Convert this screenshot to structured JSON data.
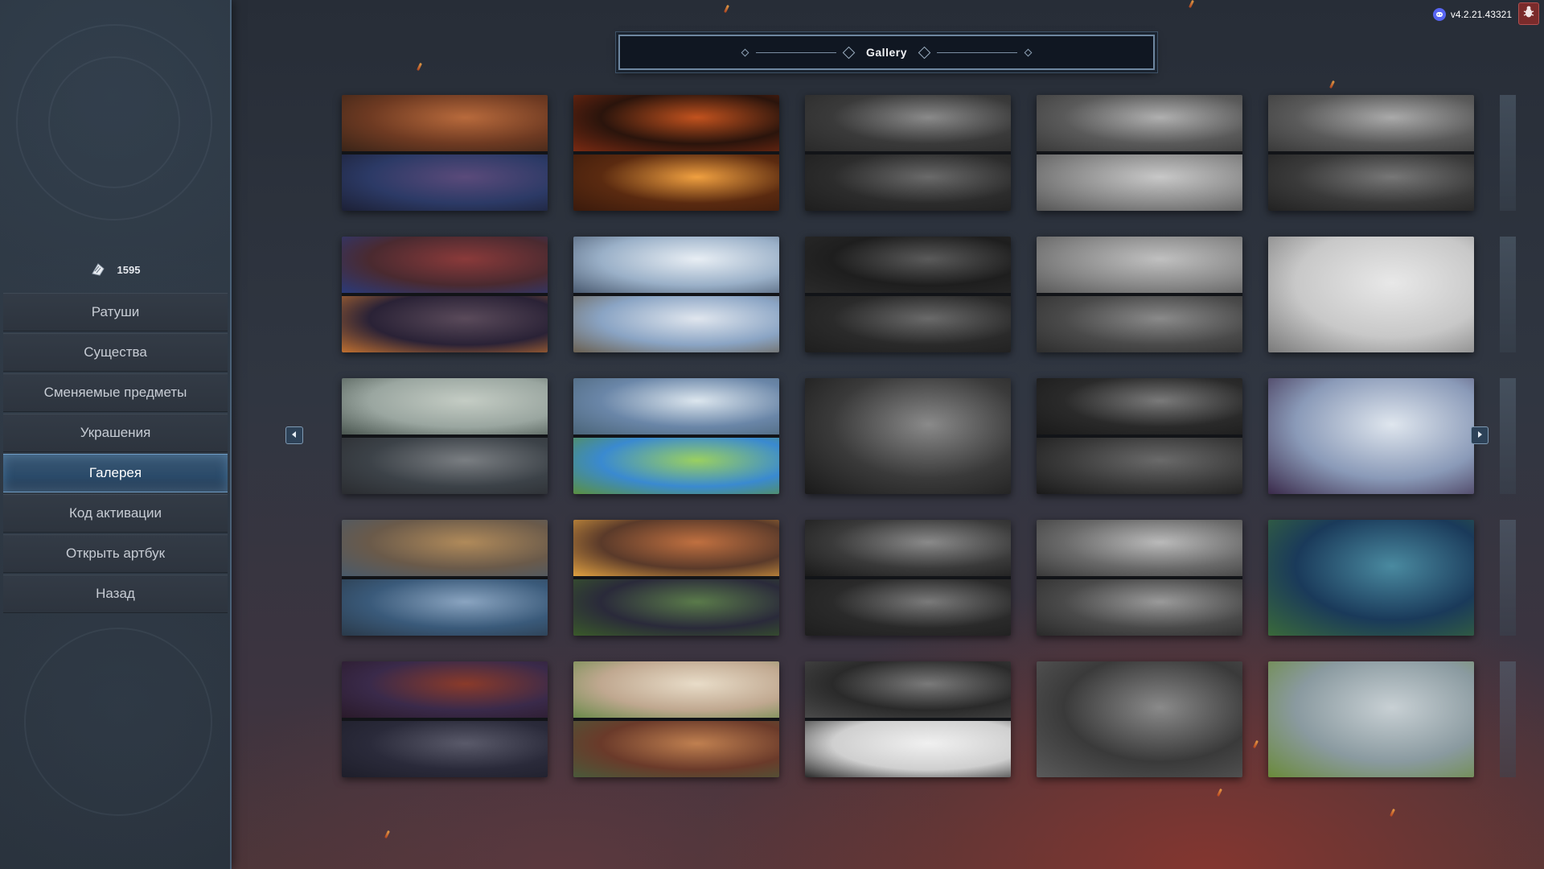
{
  "header": {
    "title": "Gallery"
  },
  "version": {
    "text": "v4.2.21.43321",
    "icon": "discord-icon"
  },
  "bug_report": {
    "icon": "bug-icon",
    "color": "#7a2b2b"
  },
  "currency": {
    "icon": "rune-shard-icon",
    "value": "1595"
  },
  "sidebar": {
    "items": [
      {
        "label": "Ратуши",
        "active": false
      },
      {
        "label": "Существа",
        "active": false
      },
      {
        "label": "Сменяемые предметы",
        "active": false
      },
      {
        "label": "Украшения",
        "active": false
      },
      {
        "label": "Галерея",
        "active": true
      },
      {
        "label": "Код активации",
        "active": false
      },
      {
        "label": "Открыть артбук",
        "active": false
      },
      {
        "label": "Назад",
        "active": false
      }
    ]
  },
  "gallery": {
    "navigation": {
      "prev_icon": "arrow-left-icon",
      "next_icon": "arrow-right-icon"
    },
    "rows": [
      [
        {
          "top": [
            "#6e3a22",
            "#b86a3c",
            "#3a2418"
          ],
          "bottom": [
            "#2c3a66",
            "#5a4a7a",
            "#1c2035"
          ]
        },
        {
          "top": [
            "#2a140c",
            "#c2521e",
            "#7a2a12"
          ],
          "bottom": [
            "#5a2a10",
            "#f0a040",
            "#3a1a0c"
          ]
        },
        {
          "top": [
            "#3a3a3a",
            "#8a8a8a",
            "#2a2a2a"
          ],
          "bottom": [
            "#2c2c2c",
            "#6a6a6a",
            "#1e1e1e"
          ]
        },
        {
          "top": [
            "#5a5a5a",
            "#b0b0b0",
            "#3a3a3a"
          ],
          "bottom": [
            "#8a8a8a",
            "#c8c8c8",
            "#555555"
          ]
        },
        {
          "top": [
            "#5a5a5a",
            "#aaaaaa",
            "#3a3a3a"
          ],
          "bottom": [
            "#3a3a3a",
            "#777777",
            "#222222"
          ]
        }
      ],
      [
        {
          "top": [
            "#4a2a30",
            "#8a3a3a",
            "#2a3a7a"
          ],
          "bottom": [
            "#2a2236",
            "#5a4a5a",
            "#c07030"
          ]
        },
        {
          "top": [
            "#9ab0c8",
            "#e8eef4",
            "#4a5a70"
          ],
          "bottom": [
            "#8aa4c4",
            "#e0e6ee",
            "#6a6050"
          ]
        },
        {
          "top": [
            "#1e1e1e",
            "#5a5a5a",
            "#2a2a2a"
          ],
          "bottom": [
            "#2a2a2a",
            "#6a6a6a",
            "#1e1e1e"
          ]
        },
        {
          "top": [
            "#8a8a8a",
            "#c0c0c0",
            "#5a5a5a"
          ],
          "bottom": [
            "#4a4a4a",
            "#8a8a8a",
            "#2e2e2e"
          ]
        }
      ],
      [
        {
          "top": [
            "#9aa6a0",
            "#c4ccc4",
            "#4a5650"
          ],
          "bottom": [
            "#3c4248",
            "#7a7e82",
            "#2a2c30"
          ]
        },
        {
          "top": [
            "#6a86a8",
            "#dce6ee",
            "#4a6478"
          ],
          "bottom": [
            "#3a8ad0",
            "#9ad060",
            "#5a9040"
          ]
        },
        {
          "top": [
            "#2a2a2a",
            "#7a7a7a",
            "#1a1a1a"
          ],
          "bottom": [
            "#3a3a3a",
            "#6a6a6a",
            "#1a1a1a"
          ]
        }
      ],
      [
        {
          "top": [
            "#6a5a4a",
            "#b08a5a",
            "#4a5a6a"
          ],
          "bottom": [
            "#3a5a7a",
            "#8aa4c0",
            "#2a3a4a"
          ]
        },
        {
          "top": [
            "#5a3a2a",
            "#c07040",
            "#e0a040"
          ],
          "bottom": [
            "#2a2a3a",
            "#5a7a4a",
            "#3a5a2a"
          ]
        },
        {
          "top": [
            "#3a3a3a",
            "#8a8a8a",
            "#1a1a1a"
          ],
          "bottom": [
            "#2a2a2a",
            "#7a7a7a",
            "#1e1e1e"
          ]
        },
        {
          "top": [
            "#6a6a6a",
            "#bababa",
            "#3a3a3a"
          ],
          "bottom": [
            "#4a4a4a",
            "#9a9a9a",
            "#2a2a2a"
          ]
        }
      ],
      [
        {
          "top": [
            "#3a2a4a",
            "#8a3a2a",
            "#2a1a2a"
          ],
          "bottom": [
            "#2a2a3a",
            "#5a5a6a",
            "#1e1e2a"
          ]
        },
        {
          "top": [
            "#c0a890",
            "#e8dcc8",
            "#6a8a4a"
          ],
          "bottom": [
            "#6a3a2a",
            "#c08050",
            "#4a5a3a"
          ]
        },
        {
          "top": [
            "#2a2a2a",
            "#7a7a7a",
            "#4a4a4a"
          ],
          "bottom": [
            "#cfcfcf",
            "#f0f0f0",
            "#2a2a2a"
          ]
        }
      ]
    ],
    "singles": [
      {
        "row": 1,
        "col": 4,
        "colors": [
          "#c8c8c8",
          "#e8e8e8",
          "#7a7a7a"
        ]
      },
      {
        "row": 2,
        "col": 2,
        "colors": [
          "#3a3a3a",
          "#8a8a8a",
          "#1a1a1a"
        ]
      },
      {
        "row": 2,
        "col": 4,
        "colors": [
          "#8a9ab8",
          "#dfe6ee",
          "#3a2a4a"
        ]
      },
      {
        "row": 3,
        "col": 4,
        "colors": [
          "#1a3a5a",
          "#4a8aa0",
          "#3a6a3a"
        ]
      },
      {
        "row": 4,
        "col": 3,
        "colors": [
          "#3a3a3a",
          "#8a8a8a",
          "#5a5a5a"
        ]
      },
      {
        "row": 4,
        "col": 4,
        "colors": [
          "#8a9aa0",
          "#c8d0d4",
          "#6a8a3a"
        ]
      }
    ]
  }
}
